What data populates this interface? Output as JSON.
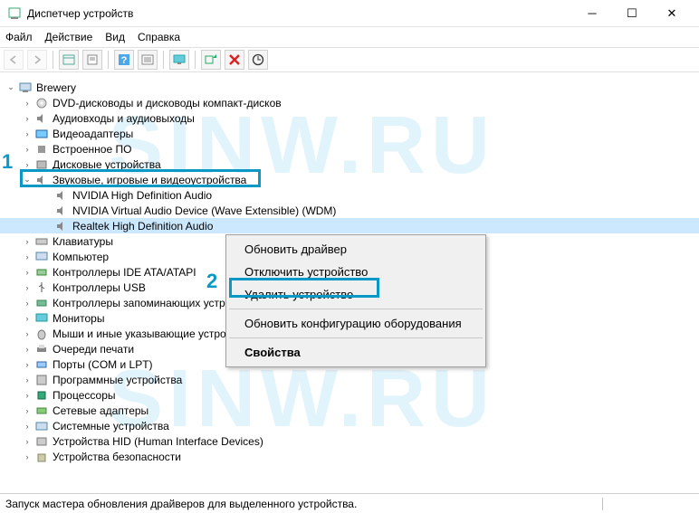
{
  "window": {
    "title": "Диспетчер устройств"
  },
  "menus": {
    "file": "Файл",
    "action": "Действие",
    "view": "Вид",
    "help": "Справка"
  },
  "tree": {
    "root": "Brewery",
    "cat": {
      "dvd": "DVD-дисководы и дисководы компакт-дисков",
      "audio_io": "Аудиовходы и аудиовыходы",
      "video": "Видеоадаптеры",
      "firmware": "Встроенное ПО",
      "disk": "Дисковые устройства",
      "sound": "Звуковые, игровые и видеоустройства",
      "keyboard": "Клавиатуры",
      "computer": "Компьютер",
      "ide": "Контроллеры IDE ATA/ATAPI",
      "usb": "Контроллеры USB",
      "storage": "Контроллеры запоминающих устройств",
      "monitor": "Мониторы",
      "mouse": "Мыши и иные указывающие устройства",
      "print": "Очереди печати",
      "ports": "Порты (COM и LPT)",
      "software": "Программные устройства",
      "cpu": "Процессоры",
      "net": "Сетевые адаптеры",
      "system": "Системные устройства",
      "hid": "Устройства HID (Human Interface Devices)",
      "security": "Устройства безопасности"
    },
    "dev": {
      "nvidia_hd": "NVIDIA High Definition Audio",
      "nvidia_virt": "NVIDIA Virtual Audio Device (Wave Extensible) (WDM)",
      "realtek": "Realtek High Definition Audio"
    }
  },
  "ctx": {
    "update": "Обновить драйвер",
    "disable": "Отключить устройство",
    "uninstall": "Удалить устройство",
    "rescan": "Обновить конфигурацию оборудования",
    "props": "Свойства"
  },
  "status": {
    "text": "Запуск мастера обновления драйверов для выделенного устройства."
  },
  "callouts": {
    "one": "1",
    "two": "2"
  },
  "watermark": "SINW.RU"
}
